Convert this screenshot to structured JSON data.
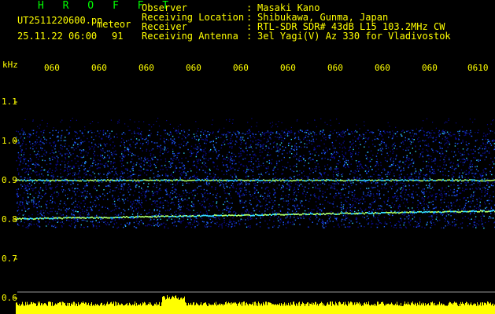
{
  "header": {
    "station": "H R O F F T",
    "filename": "UT2511220600.pn",
    "tag": "meteor",
    "datetime": "25.11.22 06:00",
    "count": "91"
  },
  "metadata": [
    {
      "key": "Observer",
      "value": "Masaki Kano"
    },
    {
      "key": "Receiving Location",
      "value": "Shibukawa, Gunma, Japan"
    },
    {
      "key": "Receiver",
      "value": "RTL-SDR SDR# 43dB L15 103.2MHz CW"
    },
    {
      "key": "Receiving Antenna",
      "value": "3el Yagi(V) Az 330 for Vladivostok"
    }
  ],
  "axis": {
    "y_unit": "kHz",
    "y_ticks": [
      "1.1",
      "1.0",
      "0.9",
      "0.8",
      "0.7",
      "0.6"
    ],
    "x_ticks": [
      "060",
      "060",
      "060",
      "060",
      "060",
      "060",
      "060",
      "060",
      "060",
      "0610"
    ]
  },
  "colors": {
    "text": "#ffff00",
    "station": "#00ff00",
    "background": "#000000",
    "noise_low": "#0a0a8c",
    "noise_mid": "#1f5fff",
    "noise_high": "#33ddff",
    "trace": "#aaff66",
    "baseline": "#ffff00"
  }
}
